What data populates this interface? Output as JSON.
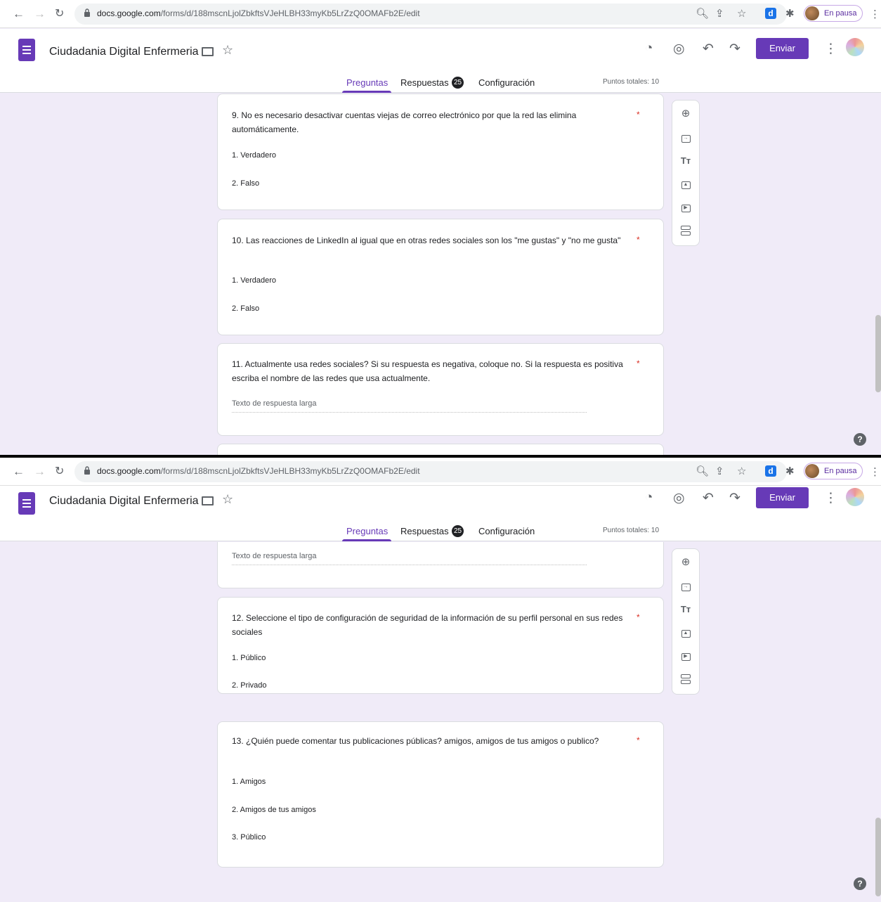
{
  "browser": {
    "url_host": "docs.google.com",
    "url_path": "/forms/d/188mscnLjolZbkftsVJeHLBH33myKb5LrZzQ0OMAFb2E/edit",
    "extension_letter": "d",
    "profile_status": "En pausa"
  },
  "app": {
    "title": "Ciudadania Digital Enfermeria",
    "send_label": "Enviar"
  },
  "tabs": {
    "questions": "Preguntas",
    "responses": "Respuestas",
    "responses_count": "25",
    "settings": "Configuración",
    "total_points": "Puntos totales: 10"
  },
  "required_mark": "*",
  "help_mark": "?",
  "frame1": {
    "q9": {
      "title": "9.   No es necesario desactivar cuentas viejas de correo electrónico por que la red las elimina automáticamente.",
      "options": [
        "1.  Verdadero",
        "2.  Falso"
      ]
    },
    "q10": {
      "title": "10.  Las reacciones de LinkedIn al igual que en otras redes sociales son los \"me gustas\" y \"no me gusta\"",
      "options": [
        "1.  Verdadero",
        "2.  Falso"
      ]
    },
    "q11": {
      "title": "11. Actualmente usa redes sociales? Si su respuesta es negativa, coloque no. Si la respuesta es positiva escriba el nombre de las redes que usa actualmente.",
      "placeholder": "Texto de respuesta larga"
    }
  },
  "frame2": {
    "q11_placeholder": "Texto de respuesta larga",
    "q12": {
      "title": "12. Seleccione el tipo de configuración de seguridad de la información de su perfil personal en sus redes sociales",
      "options": [
        "1.  Público",
        "2.  Privado"
      ]
    },
    "q13": {
      "title": "13. ¿Quién puede comentar tus publicaciones públicas? amigos, amigos de tus amigos o publico?",
      "options": [
        "1.  Amigos",
        "2.  Amigos de tus amigos",
        "3.  Público"
      ]
    }
  }
}
